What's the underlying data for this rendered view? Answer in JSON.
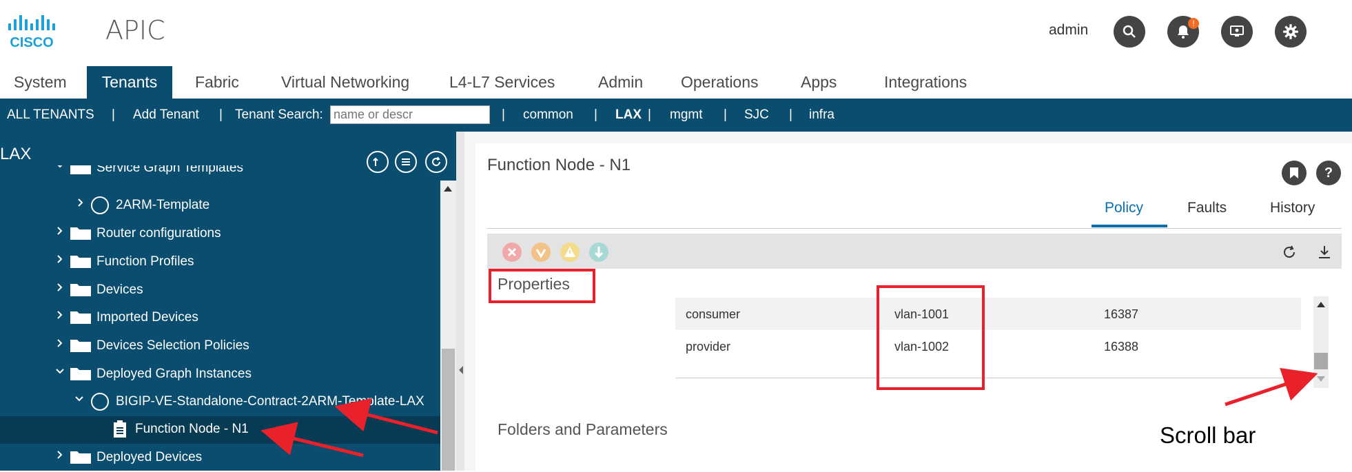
{
  "header": {
    "app_title": "APIC",
    "user": "admin",
    "notification_count": "!",
    "icons": [
      "cisco-logo",
      "search-icon",
      "bell-icon",
      "monitor-icon",
      "gear-icon"
    ]
  },
  "nav": {
    "tabs": [
      "System",
      "Tenants",
      "Fabric",
      "Virtual Networking",
      "L4-L7 Services",
      "Admin",
      "Operations",
      "Apps",
      "Integrations"
    ],
    "active": "Tenants"
  },
  "subnav": {
    "all_tenants": "ALL TENANTS",
    "add_tenant": "Add Tenant",
    "search_label": "Tenant Search:",
    "search_placeholder": "name or descr",
    "tenants": [
      "common",
      "LAX",
      "mgmt",
      "SJC",
      "infra"
    ],
    "separator": "|"
  },
  "sidebar": {
    "title": "LAX",
    "items": [
      {
        "label": "Service Graph Templates"
      },
      {
        "label": "2ARM-Template"
      },
      {
        "label": "Router configurations"
      },
      {
        "label": "Function Profiles"
      },
      {
        "label": "Devices"
      },
      {
        "label": "Imported Devices"
      },
      {
        "label": "Devices Selection Policies"
      },
      {
        "label": "Deployed Graph Instances"
      },
      {
        "label": "BIGIP-VE-Standalone-Contract-2ARM-Template-LAX"
      },
      {
        "label": "Function Node - N1"
      },
      {
        "label": "Deployed Devices"
      }
    ]
  },
  "panel": {
    "title": "Function Node - N1",
    "tabs": [
      "Policy",
      "Faults",
      "History"
    ],
    "active_tab": "Policy",
    "properties_title": "Properties",
    "folders_title": "Folders and Parameters",
    "table_rows": [
      {
        "name": "consumer",
        "encap": "vlan-1001",
        "id": "16387"
      },
      {
        "name": "provider",
        "encap": "vlan-1002",
        "id": "16388"
      }
    ]
  },
  "annotation": {
    "callout": "Scroll bar",
    "color": "#e8212b"
  },
  "colors": {
    "brand_dark": "#0a4d6e",
    "selected_row": "#073a53",
    "accent": "#0a6fb0"
  }
}
